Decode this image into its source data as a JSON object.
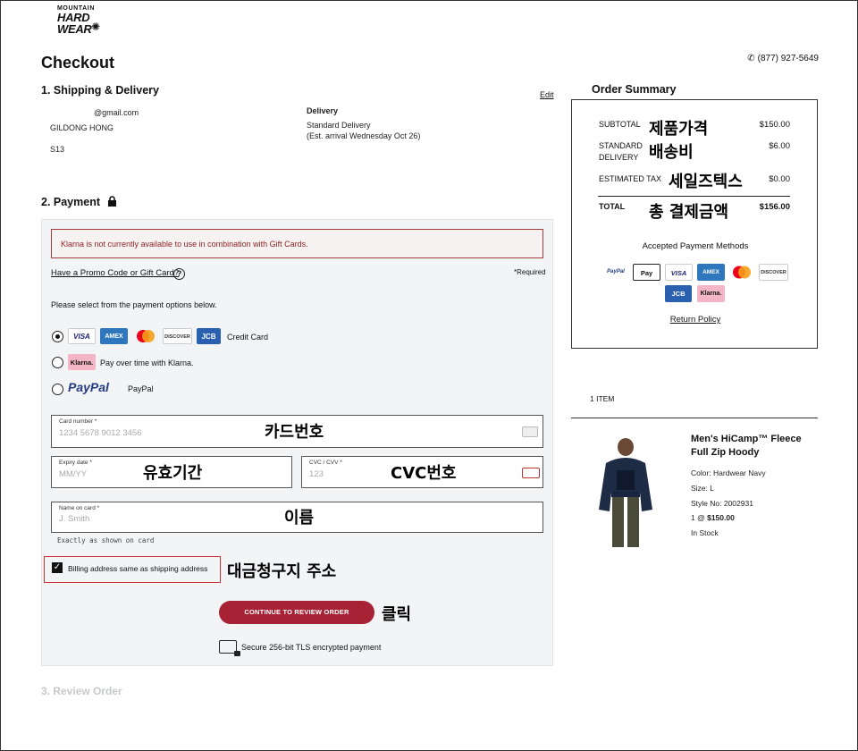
{
  "brand": {
    "line1": "MOUNTAIN",
    "line2": "HARD",
    "line3": "WEAR"
  },
  "page_title": "Checkout",
  "phone": "(877) 927-5649",
  "shipping": {
    "title": "1. Shipping & Delivery",
    "edit": "Edit",
    "email": "@gmail.com",
    "name": "GILDONG HONG",
    "address": "S13",
    "delivery_label": "Delivery",
    "delivery_method": "Standard Delivery",
    "delivery_estimate": "(Est. arrival Wednesday Oct 26)"
  },
  "payment": {
    "title": "2. Payment",
    "alert": "Klarna is not currently available to use in combination with Gift Cards.",
    "promo_link": "Have a Promo Code or Gift Card?",
    "help": "?",
    "required": "*Required",
    "select_text": "Please select from the payment options below.",
    "options": [
      {
        "label": "Credit Card",
        "selected": true
      },
      {
        "label": "Pay over time with Klarna.",
        "selected": false
      },
      {
        "label": "PayPal",
        "selected": false
      }
    ],
    "card_badges": [
      "VISA",
      "AMEX",
      "",
      "DISCOVER",
      "JCB"
    ],
    "klarna_badge": "Klarna.",
    "paypal_logo": "PayPal",
    "fields": {
      "card_number": {
        "label": "Card number *",
        "placeholder": "1234 5678 9012 3456"
      },
      "expiry": {
        "label": "Expiry date *",
        "placeholder": "MM/YY"
      },
      "cvc": {
        "label": "CVC / CVV *",
        "placeholder": "123"
      },
      "name": {
        "label": "Name on card *",
        "placeholder": "J. Smith"
      }
    },
    "name_hint": "Exactly as shown on card",
    "billing_same": "Billing address same as shipping address",
    "billing_checked": true,
    "continue_button": "CONTINUE TO REVIEW ORDER",
    "secure_text": "Secure 256-bit TLS encrypted payment"
  },
  "review_title": "3. Review Order",
  "annotations": {
    "card_number": "카드번호",
    "expiry": "유효기간",
    "cvc": "CVC번호",
    "name": "이름",
    "billing": "대금청구지 주소",
    "click": "클릭",
    "subtotal": "제품가격",
    "shipping": "배송비",
    "tax": "세일즈텍스",
    "total": "총 결제금액"
  },
  "summary": {
    "title": "Order Summary",
    "subtotal_label": "SUBTOTAL",
    "subtotal_value": "$150.00",
    "shipping_label_1": "STANDARD",
    "shipping_label_2": "DELIVERY",
    "shipping_value": "$6.00",
    "tax_label": "ESTIMATED TAX",
    "tax_value": "$0.00",
    "total_label": "TOTAL",
    "total_value": "$156.00",
    "accepted": "Accepted Payment Methods",
    "methods": [
      "PayPal",
      "Pay",
      "VISA",
      "AMEX",
      "",
      "DISCOVER",
      "JCB",
      "Klarna."
    ],
    "return_policy": "Return Policy"
  },
  "items": {
    "count": "1 ITEM",
    "product": {
      "name": "Men's HiCamp™ Fleece Full Zip Hoody",
      "color": "Color: Hardwear Navy",
      "size": "Size: L",
      "style": "Style No: 2002931",
      "qty_prefix": "1 @ ",
      "price": "$150.00",
      "stock": "In Stock"
    }
  },
  "colors": {
    "accent": "#a62234",
    "alert_border": "#a63a3a",
    "highlight_border": "#cc3333"
  }
}
